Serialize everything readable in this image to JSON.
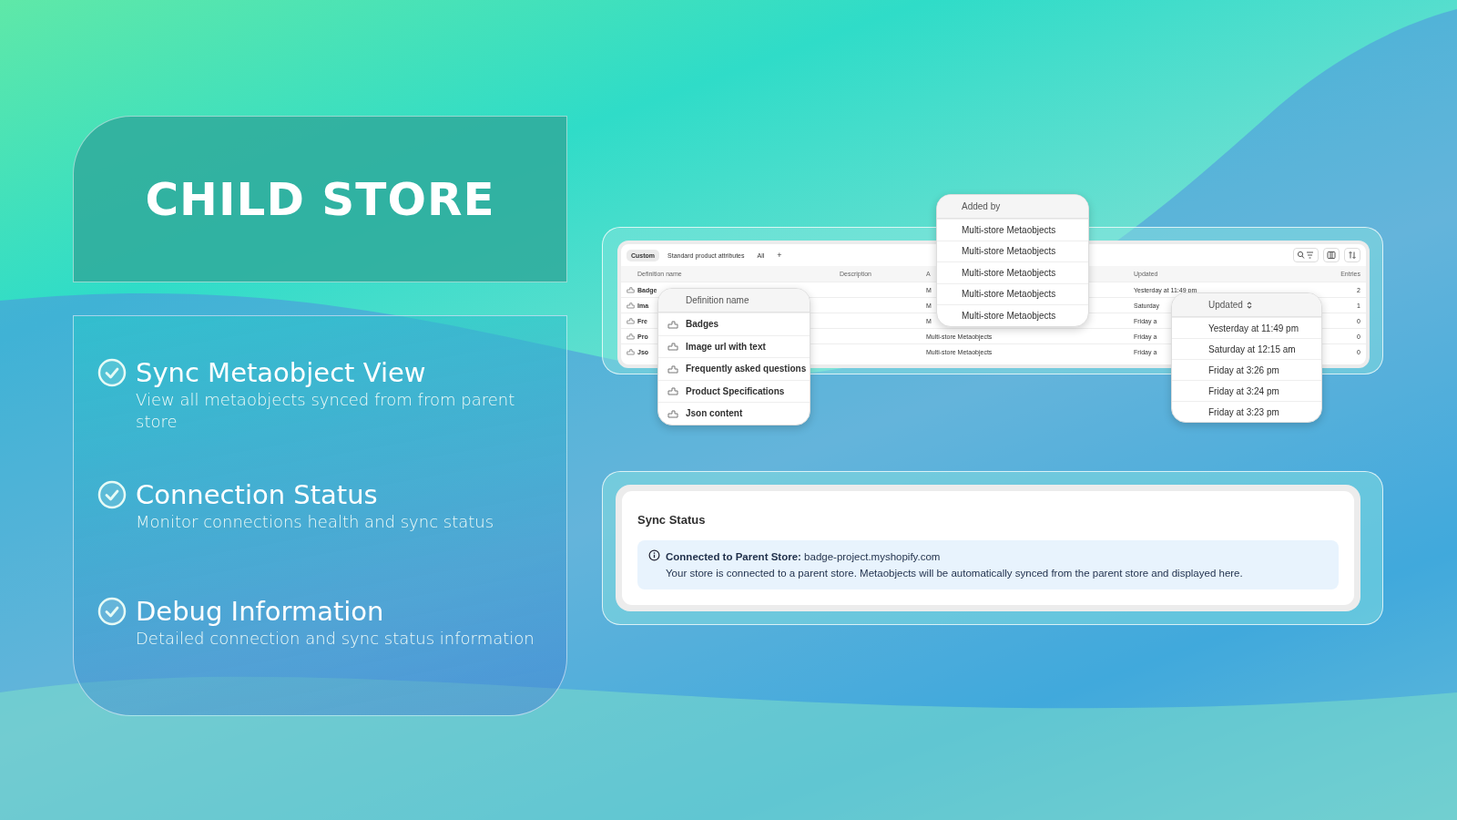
{
  "headline": "CHILD STORE",
  "features": [
    {
      "title": "Sync Metaobject View",
      "description": "View all metaobjects synced from from parent store"
    },
    {
      "title": "Connection Status",
      "description": "Monitor connections health and sync status"
    },
    {
      "title": "Debug Information",
      "description": "Detailed connection and sync status information"
    }
  ],
  "table": {
    "tabs": [
      {
        "label": "Custom",
        "selected": true
      },
      {
        "label": "Standard product attributes",
        "selected": false
      },
      {
        "label": "All",
        "selected": false
      }
    ],
    "add_tab": "+",
    "columns": [
      "Definition name",
      "Description",
      "A",
      "Updated",
      "Entries"
    ],
    "rows": [
      {
        "name": "Badge",
        "added_by": "M",
        "updated": "Yesterday at 11:49 pm",
        "entries": "2"
      },
      {
        "name": "Ima",
        "added_by": "M",
        "updated": "Saturday",
        "entries": "1"
      },
      {
        "name": "Fre",
        "added_by": "M",
        "updated": "Friday a",
        "entries": "0"
      },
      {
        "name": "Pro",
        "added_by": "Multi-store Metaobjects",
        "updated": "Friday a",
        "entries": "0"
      },
      {
        "name": "Jso",
        "added_by": "Multi-store Metaobjects",
        "updated": "Friday a",
        "entries": "0"
      }
    ]
  },
  "definition_popup": {
    "header": "Definition name",
    "items": [
      "Badges",
      "Image url with text",
      "Frequently asked questions",
      "Product Specifications",
      "Json content"
    ]
  },
  "added_by_popup": {
    "header": "Added by",
    "items": [
      "Multi-store Metaobjects",
      "Multi-store Metaobjects",
      "Multi-store Metaobjects",
      "Multi-store Metaobjects",
      "Multi-store Metaobjects"
    ]
  },
  "updated_popup": {
    "header": "Updated",
    "items": [
      "Yesterday at 11:49 pm",
      "Saturday at 12:15 am",
      "Friday at 3:26 pm",
      "Friday at 3:24 pm",
      "Friday at 3:23 pm"
    ]
  },
  "sync_status": {
    "title": "Sync Status",
    "banner": "**Connected to Parent Store:** badge-project.myshopify.com",
    "message": "Your store is connected to a parent store. Metaobjects will be automatically synced from the parent store and displayed here."
  }
}
